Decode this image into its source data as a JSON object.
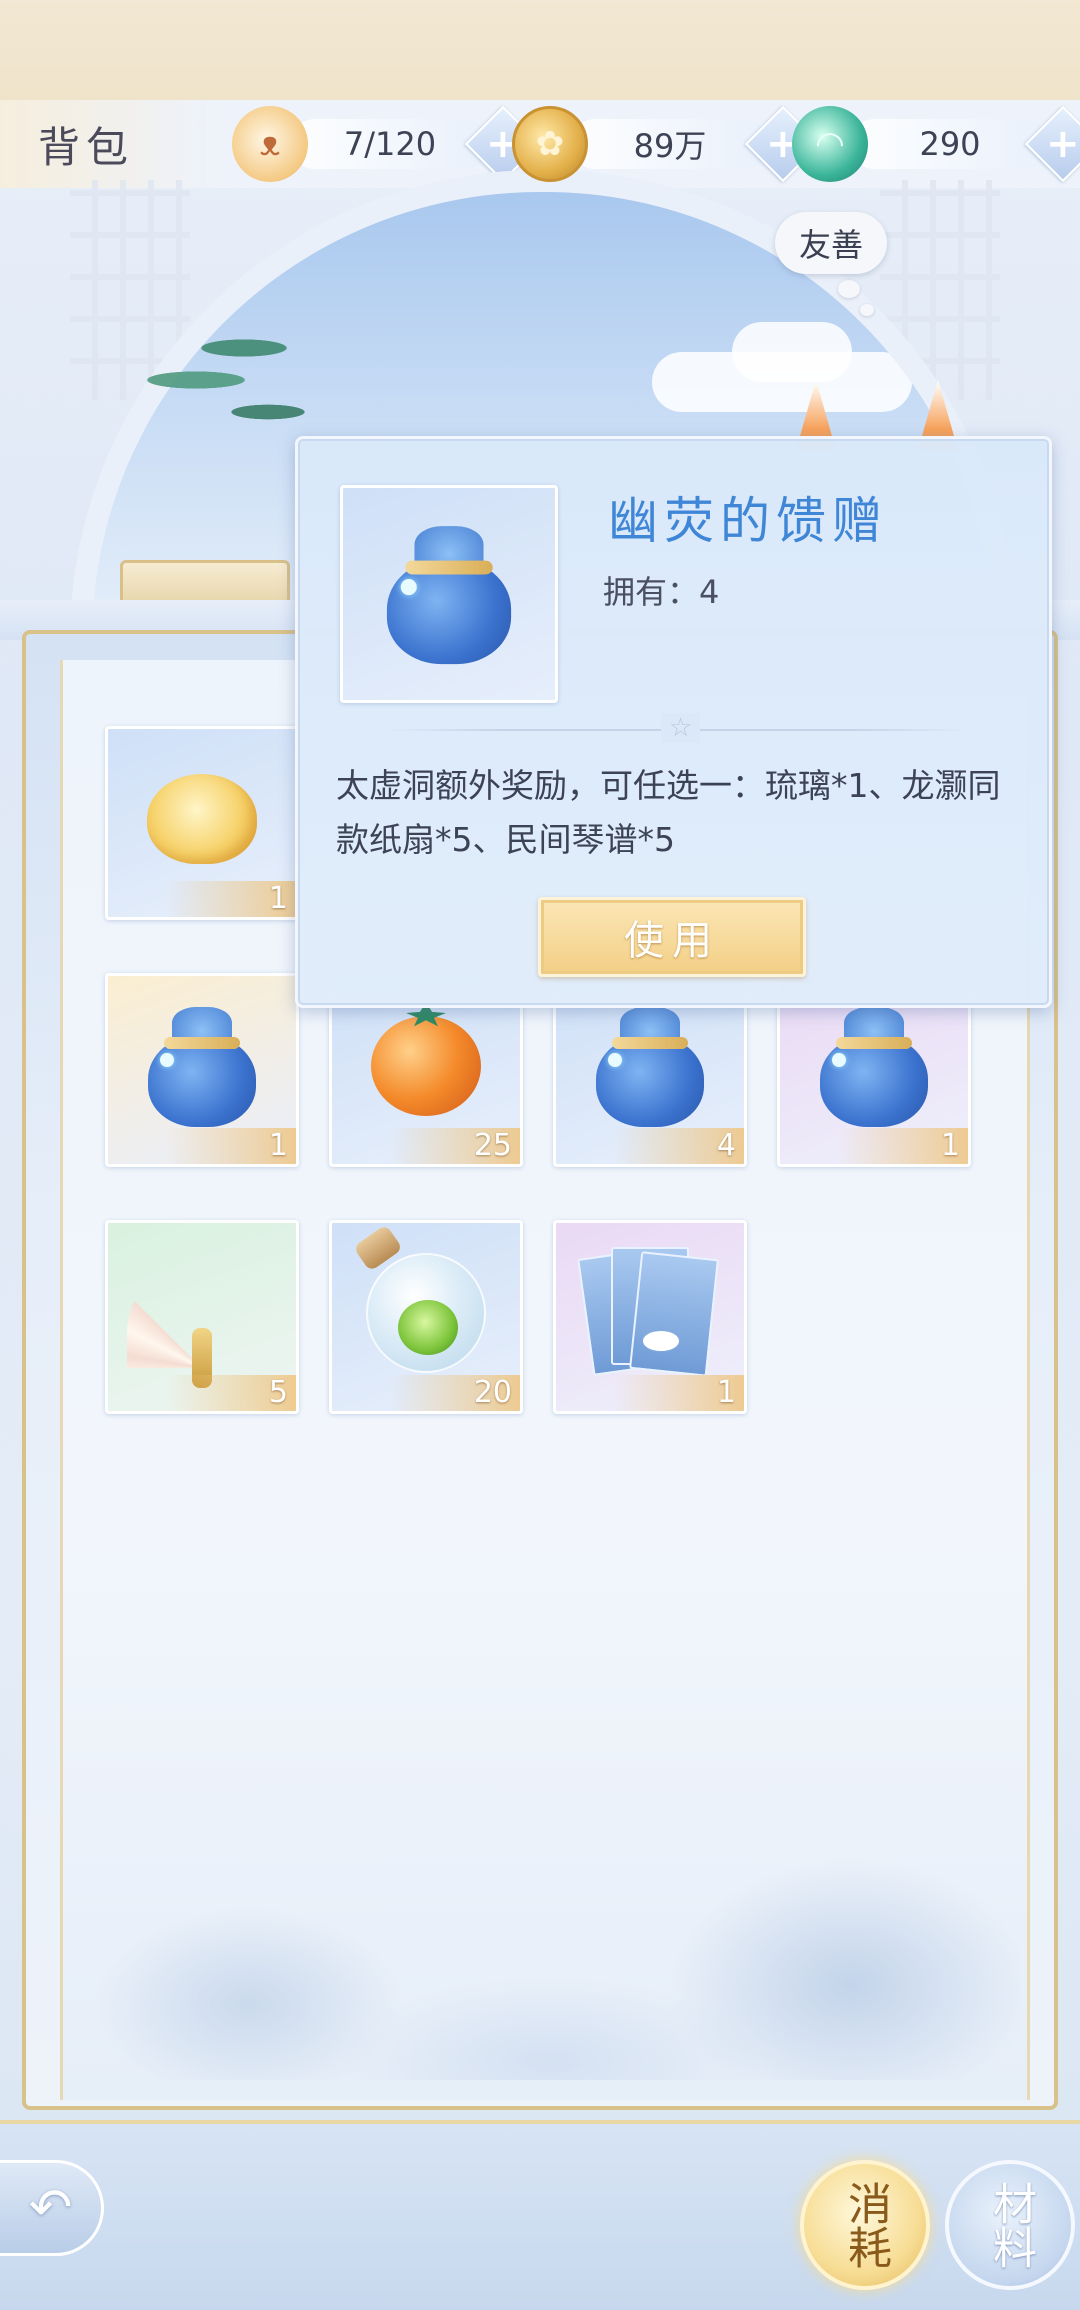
{
  "header": {
    "title": "背包",
    "capacity": {
      "icon": "cat-icon",
      "value": "7/120"
    },
    "coins": {
      "icon": "paw-coin-icon",
      "value": "89万"
    },
    "jade": {
      "icon": "jade-fish-icon",
      "value": "290"
    },
    "plus_label": "+"
  },
  "scene": {
    "mood_bubble": "友善"
  },
  "inventory": {
    "items": [
      {
        "icon": "golden-rose-icon",
        "count": "1",
        "rarity": "blue"
      },
      {
        "icon": "blue-pouch-icon",
        "count": "1",
        "rarity": "gold"
      },
      {
        "icon": "persimmon-icon",
        "count": "25",
        "rarity": "blue"
      },
      {
        "icon": "blue-pouch-icon",
        "count": "4",
        "rarity": "blue"
      },
      {
        "icon": "blue-pouch-icon",
        "count": "1",
        "rarity": "purple"
      },
      {
        "icon": "paper-fan-icon",
        "count": "5",
        "rarity": "green"
      },
      {
        "icon": "potion-flask-icon",
        "count": "20",
        "rarity": "blue"
      },
      {
        "icon": "scroll-book-icon",
        "count": "1",
        "rarity": "purple"
      }
    ]
  },
  "popup": {
    "title": "幽荧的馈赠",
    "owned": "拥有：4",
    "divider_glyph": "☆",
    "description": "太虚洞额外奖励，可任选一：琉璃*1、龙灏同款纸扇*5、民间琴谱*5",
    "use_button": "使用"
  },
  "bottom": {
    "back_glyph": "↶",
    "tab_consumables": "消耗",
    "tab_materials": "材料"
  },
  "colors": {
    "accent_blue": "#3f86d6",
    "gold": "#f3cf86",
    "panel_border": "#d9c289"
  }
}
